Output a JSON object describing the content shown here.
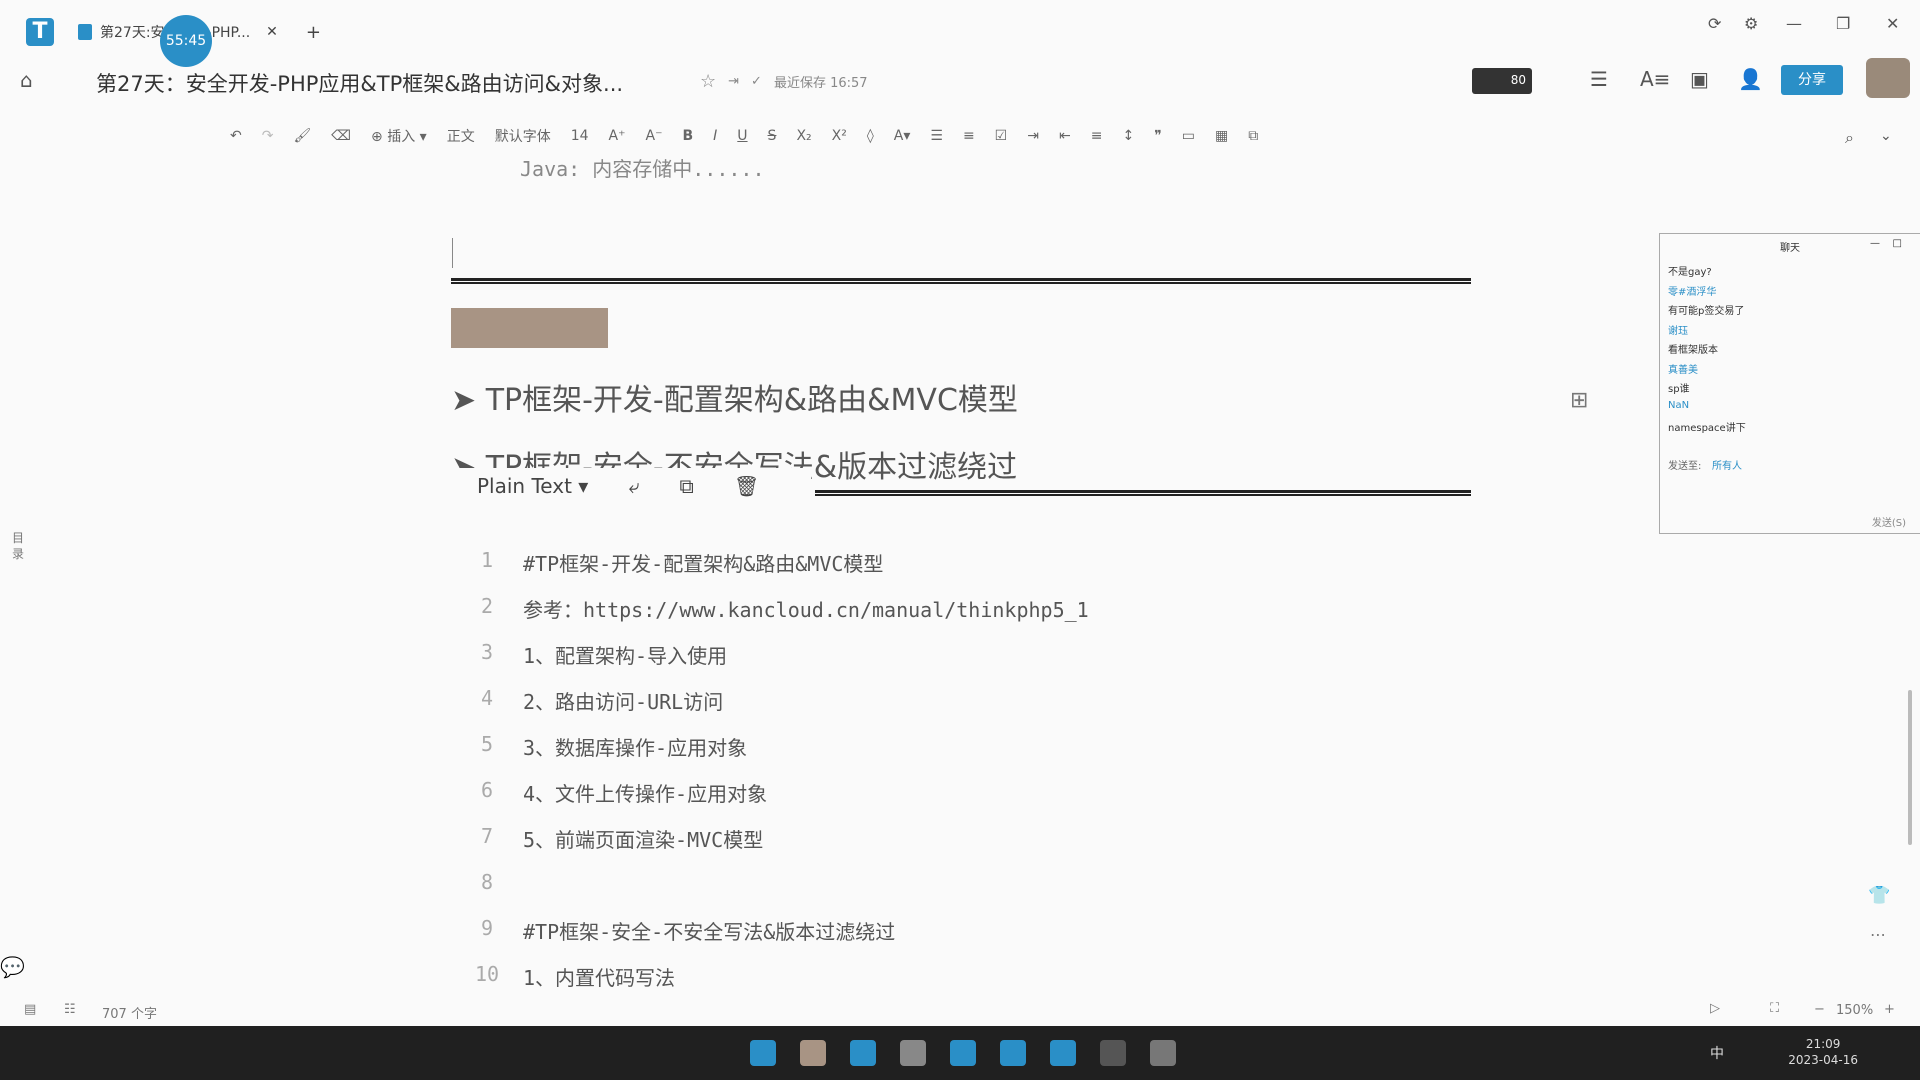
{
  "window": {
    "tab_title": "第27天:安全开发-PHP...",
    "timer": "55:45"
  },
  "header": {
    "doc_title": "第27天：安全开发-PHP应用&TP框架&路由访问&对象...",
    "saved": "最近保存 16:57",
    "share": "分享",
    "badge": "80"
  },
  "toolbar": {
    "insert": "插入",
    "style": "正文",
    "font": "默认字体",
    "size": "14",
    "bold": "B",
    "italic": "I",
    "underline": "U"
  },
  "doc": {
    "top_line": "Java: 内容存储中......",
    "heading1": "TP框架-开发-配置架构&路由&MVC模型",
    "heading2": "TP框架-安全-不安全写法&版本过滤绕过",
    "toc": "目录",
    "code_block": {
      "language": "Plain Text",
      "lines": [
        {
          "n": "1",
          "t": "#TP框架-开发-配置架构&路由&MVC模型"
        },
        {
          "n": "2",
          "t": "参考：https://www.kancloud.cn/manual/thinkphp5_1"
        },
        {
          "n": "3",
          "t": "1、配置架构-导入使用"
        },
        {
          "n": "4",
          "t": "2、路由访问-URL访问"
        },
        {
          "n": "5",
          "t": "3、数据库操作-应用对象"
        },
        {
          "n": "6",
          "t": "4、文件上传操作-应用对象"
        },
        {
          "n": "7",
          "t": "5、前端页面渲染-MVC模型"
        },
        {
          "n": "8",
          "t": ""
        },
        {
          "n": "9",
          "t": "#TP框架-安全-不安全写法&版本过滤绕过"
        },
        {
          "n": "10",
          "t": "1、内置代码写法"
        }
      ]
    }
  },
  "chat": {
    "title": "聊天",
    "messages": [
      {
        "t": "不是gay?",
        "c": "#333"
      },
      {
        "t": "零#酒浮华",
        "c": "#2a8fc7"
      },
      {
        "t": "有可能p签交易了",
        "c": "#333"
      },
      {
        "t": "谢珏",
        "c": "#2a8fc7"
      },
      {
        "t": "看框架版本",
        "c": "#333"
      },
      {
        "t": "真善美",
        "c": "#2a8fc7"
      },
      {
        "t": "sp谁",
        "c": "#333"
      },
      {
        "t": "NaN",
        "c": "#2a8fc7"
      },
      {
        "t": "namespace讲下",
        "c": "#333"
      }
    ],
    "send_to_label": "发送至:",
    "send_to": "所有人",
    "send": "发送(S)"
  },
  "status": {
    "word_count": "707 个字",
    "zoom": "150%"
  },
  "taskbar": {
    "time": "21:09",
    "date": "2023-04-16",
    "ime": "中"
  },
  "colors": {
    "accent": "#2a8fc7",
    "taskbar": "#202020"
  }
}
